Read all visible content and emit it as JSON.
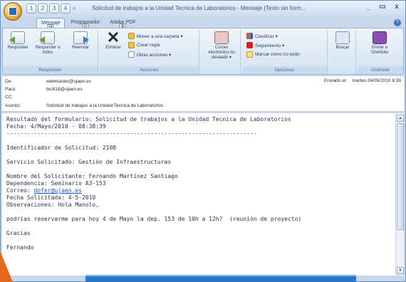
{
  "window": {
    "title": "Solicitud de trabajos a la Unidad Tecnica de Laboratorios - Mensaje (Texto sin form...",
    "controls": [
      "_",
      "▭",
      "x"
    ]
  },
  "qat": {
    "separator": "=",
    "keytips": [
      "1",
      "2",
      "3",
      "4"
    ]
  },
  "tabs": [
    {
      "label": "Mensaje",
      "keytip": "H"
    },
    {
      "label": "Programador",
      "keytip": "G"
    },
    {
      "label": "Adobe PDF",
      "keytip": "B"
    }
  ],
  "ribbon": {
    "responder": {
      "label": "Responder",
      "buttons": {
        "reply": "Responder",
        "reply_all": "Responder a todos",
        "forward": "Reenviar"
      }
    },
    "acciones": {
      "label": "Acciones",
      "delete": "Eliminar",
      "move": "Mover a una carpeta ▾",
      "rule": "Crear regla",
      "other": "Otras acciones ▾"
    },
    "junk": {
      "label": "Correo electrónico no deseado ▾"
    },
    "opciones": {
      "label": "Opciones",
      "categorize": "Clasificar ▾",
      "followup": "Seguimiento ▾",
      "mark_unread": "Marcar como no leído"
    },
    "find": {
      "label": "Buscar"
    },
    "onenote": {
      "label": "OneNote",
      "send": "Enviar a OneNote"
    }
  },
  "header": {
    "from_label": "De:",
    "from": "webmaster@ujaen.es",
    "to_label": "Para:",
    "to": "tec618@ujaen.es",
    "cc_label": "CC:",
    "cc": "",
    "subject_label": "Asunto:",
    "subject": "Solicitud de trabajos a la Unidad Tecnica de Laboratorios",
    "sent_label": "Enviado el:",
    "sent": "martes 04/05/2010 8:39"
  },
  "body": {
    "l1": "Resultado del formulario: Solicitud de trabajos a la Unidad Tecnica de Laboratorios",
    "l2": "Fecha: 4/Mayo/2010 - 08:38:39",
    "l3": "-------------------------------------------------------------------------",
    "l4": "Identificador de Solicitud: 2108",
    "l5": "Servicio Solicitado: Gestión de Infraestructuras",
    "l6": "Nombre del Solicitante: Fernando Martínez Santiago",
    "l7": "Dependencia: Seminario A3-153",
    "l8_label": "Correo: ",
    "l8_link": "dofer@ujaen.es",
    "l9": "Fecha Solicitada: 4-5-2010",
    "l10": "Observaciones: Hola Manolo,",
    "l11": "podrías reservarme para hoy 4 de Mayo la dep. 153 de 10h a 12h?  (reunión de proyecto)",
    "l12": "Gracias",
    "l13": "Fernando"
  }
}
